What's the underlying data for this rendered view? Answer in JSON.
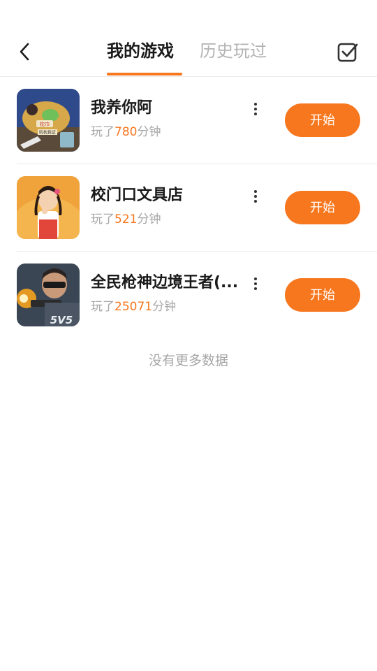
{
  "header": {
    "tabs": [
      {
        "label": "我的游戏",
        "active": true
      },
      {
        "label": "历史玩过",
        "active": false
      }
    ],
    "back_icon": "chevron-left-icon",
    "manage_icon": "checkbox-checked-icon"
  },
  "games": [
    {
      "title": "我养你阿",
      "played_prefix": "玩了",
      "minutes": "780",
      "played_suffix": "分钟",
      "start_label": "开始"
    },
    {
      "title": "校门口文具店",
      "played_prefix": "玩了",
      "minutes": "521",
      "played_suffix": "分钟",
      "start_label": "开始"
    },
    {
      "title": "全民枪神边境王者(...",
      "played_prefix": "玩了",
      "minutes": "25071",
      "played_suffix": "分钟",
      "start_label": "开始"
    }
  ],
  "thumb_text": {
    "game1_tag": "枕巾",
    "game1_caption": "吼枕我证",
    "game3_badge": "5V5"
  },
  "footer": {
    "no_more": "没有更多数据"
  },
  "colors": {
    "accent": "#f7771e",
    "muted": "#a6a6a6",
    "divider": "#ececec"
  }
}
